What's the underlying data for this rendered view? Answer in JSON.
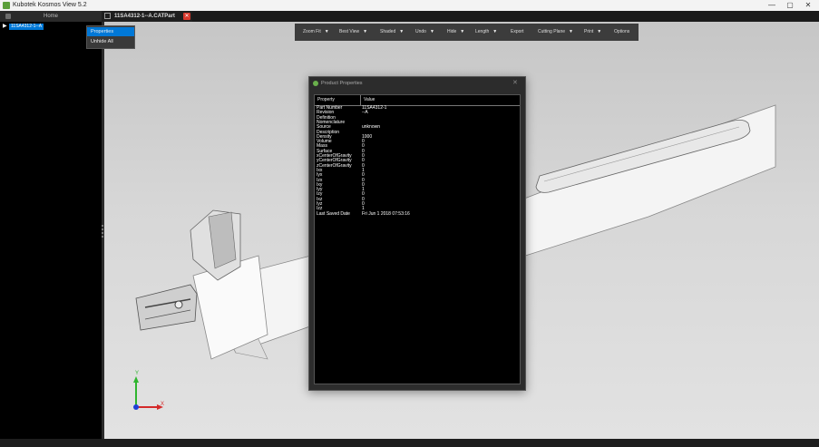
{
  "window": {
    "title": "Kubotek Kosmos View 5.2",
    "controls": [
      "—",
      "▢",
      "✕"
    ]
  },
  "tabs": {
    "home_label": "Home",
    "document_label": "11SA4312-1--A.CATPart"
  },
  "tree": {
    "items": [
      {
        "label": "11SA4312-1--A"
      }
    ]
  },
  "context_menu": {
    "items": [
      "Properties",
      "Unhide All"
    ],
    "active": "Properties"
  },
  "toolbar": {
    "items": [
      {
        "label": "Zoom Fit",
        "has_dropdown": true
      },
      {
        "label": "Best View",
        "has_dropdown": true
      },
      {
        "label": "Shaded",
        "has_dropdown": true
      },
      {
        "label": "Undo",
        "has_dropdown": true
      },
      {
        "label": "Hide",
        "has_dropdown": true
      },
      {
        "label": "Length",
        "has_dropdown": true
      },
      {
        "label": "Export",
        "has_dropdown": false
      },
      {
        "label": "Cutting Plane",
        "has_dropdown": true
      },
      {
        "label": "Print",
        "has_dropdown": true
      },
      {
        "label": "Options",
        "has_dropdown": false
      }
    ]
  },
  "dialog": {
    "title": "Product Properties",
    "columns": [
      "Property",
      "Value"
    ],
    "rows": [
      {
        "property": "Part Number",
        "value": "11SA4312-1"
      },
      {
        "property": "Revision",
        "value": "--A"
      },
      {
        "property": "Definition",
        "value": ""
      },
      {
        "property": "Nomenclature",
        "value": ""
      },
      {
        "property": "Source",
        "value": "unknown"
      },
      {
        "property": "Description",
        "value": ""
      },
      {
        "property": "Density",
        "value": "1000"
      },
      {
        "property": "Volume",
        "value": "0"
      },
      {
        "property": "Mass",
        "value": "0"
      },
      {
        "property": "Surface",
        "value": "0"
      },
      {
        "property": "xCenterOfGravity",
        "value": "0"
      },
      {
        "property": "yCenterOfGravity",
        "value": "0"
      },
      {
        "property": "zCenterOfGravity",
        "value": "0"
      },
      {
        "property": "Ixx",
        "value": "1"
      },
      {
        "property": "Iyx",
        "value": "0"
      },
      {
        "property": "Izx",
        "value": "0"
      },
      {
        "property": "Ixy",
        "value": "0"
      },
      {
        "property": "Iyy",
        "value": "1"
      },
      {
        "property": "Izy",
        "value": "0"
      },
      {
        "property": "Ixz",
        "value": "0"
      },
      {
        "property": "Iyz",
        "value": "0"
      },
      {
        "property": "Izz",
        "value": "1"
      },
      {
        "property": "Last Saved Date",
        "value": "Fri Jun 1 2018 07:53:16"
      }
    ]
  },
  "axes": {
    "y_label": "Y",
    "x_label": "X"
  },
  "colors": {
    "accent": "#0078d7",
    "close_tab": "#d9382c",
    "axis_y": "#2fb52f",
    "axis_x": "#d42a2a",
    "axis_z": "#1f3fd6"
  }
}
